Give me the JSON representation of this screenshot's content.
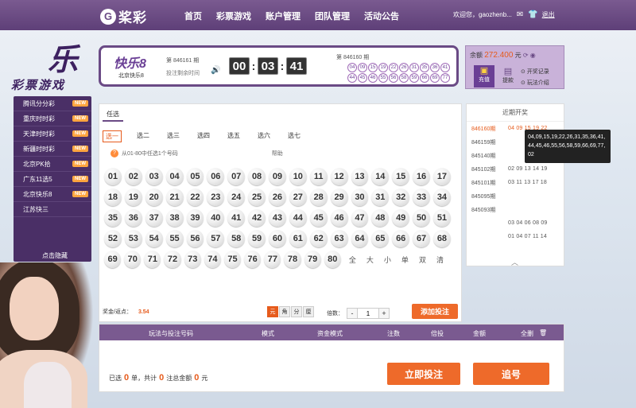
{
  "header": {
    "logo_badge": "G",
    "logo_text": "桨彩",
    "nav": [
      "首页",
      "彩票游戏",
      "账户管理",
      "团队管理",
      "活动公告"
    ],
    "welcome": "欢迎您，gaozhenb...",
    "logout": "退出"
  },
  "promo": {
    "title": "乐",
    "subtitle": "彩票游戏"
  },
  "sidebar": {
    "items": [
      {
        "label": "腾讯分分彩",
        "badge": "NEW"
      },
      {
        "label": "重庆时时彩",
        "badge": "NEW"
      },
      {
        "label": "天津时时彩",
        "badge": "NEW"
      },
      {
        "label": "新疆时时彩",
        "badge": "NEW"
      },
      {
        "label": "北京PK拾",
        "badge": "NEW"
      },
      {
        "label": "广东11选5",
        "badge": "NEW"
      },
      {
        "label": "北京快乐8",
        "badge": "NEW"
      },
      {
        "label": "江苏快三",
        "badge": ""
      }
    ],
    "hide": "点击隐藏"
  },
  "game": {
    "logo": "快乐8",
    "name": "北京快乐8",
    "issue_now": "第 846161 期",
    "issue_label": "投注剩余时间",
    "timer": [
      "00",
      "03",
      "41"
    ],
    "last_issue": "第 846160 期",
    "last_balls": [
      "04",
      "09",
      "15",
      "19",
      "22",
      "26",
      "31",
      "35",
      "36",
      "41",
      "44",
      "45",
      "46",
      "55",
      "56",
      "58",
      "59",
      "66",
      "69",
      "77"
    ]
  },
  "balance": {
    "label": "余额",
    "amount": "272.400",
    "unit": "元",
    "recharge": "充值",
    "withdraw": "提款",
    "link_record": "开奖记录",
    "link_intro": "玩法介绍"
  },
  "play": {
    "tab": "任选",
    "subtabs": [
      "选一",
      "选二",
      "选三",
      "选四",
      "选五",
      "选六",
      "选七"
    ],
    "hint": "从01-80中任选1个号码",
    "help": "帮助",
    "rows": [
      [
        "01",
        "02",
        "03",
        "04",
        "05",
        "06",
        "07",
        "08",
        "09",
        "10",
        "11",
        "12",
        "13",
        "14",
        "15",
        "16",
        "17"
      ],
      [
        "18",
        "19",
        "20",
        "21",
        "22",
        "23",
        "24",
        "25",
        "26",
        "27",
        "28",
        "29",
        "30",
        "31",
        "32",
        "33",
        "34"
      ],
      [
        "35",
        "36",
        "37",
        "38",
        "39",
        "40",
        "41",
        "42",
        "43",
        "44",
        "45",
        "46",
        "47",
        "48",
        "49",
        "50",
        "51"
      ],
      [
        "52",
        "53",
        "54",
        "55",
        "56",
        "57",
        "58",
        "59",
        "60",
        "61",
        "62",
        "63",
        "64",
        "65",
        "66",
        "67",
        "68"
      ],
      [
        "69",
        "70",
        "71",
        "72",
        "73",
        "74",
        "75",
        "76",
        "77",
        "78",
        "79",
        "80"
      ]
    ],
    "quick": [
      "全",
      "大",
      "小",
      "单",
      "双",
      "清"
    ],
    "odds_label": "奖金/返点：",
    "odds_value": "3.54",
    "units": [
      "元",
      "角",
      "分",
      "厘"
    ],
    "multiple_label": "倍数：",
    "multiple_value": "1",
    "minus": "-",
    "plus": "+",
    "add_bet": "添加投注"
  },
  "recent": {
    "title": "近期开奖",
    "rows": [
      {
        "issue": "846160期",
        "nums": "04 09 15 19 22"
      },
      {
        "issue": "846159期",
        "nums": ""
      },
      {
        "issue": "845140期",
        "nums": ""
      },
      {
        "issue": "845102期",
        "nums": "02 09 13 14 19"
      },
      {
        "issue": "845101期",
        "nums": "03 11 13 17 18"
      },
      {
        "issue": "845095期",
        "nums": ""
      },
      {
        "issue": "845093期",
        "nums": ""
      },
      {
        "issue": "",
        "nums": "03 04 06 08 09"
      },
      {
        "issue": "",
        "nums": "01 04 07 11 14"
      }
    ],
    "tooltip": "04,09,15,19,22,26,31,35,36,41,44,45,46,55,56,58,59,66,69,77,02"
  },
  "bets": {
    "columns": [
      "玩法与投注号码",
      "模式",
      "资金模式",
      "注数",
      "倍投",
      "金额",
      "全删"
    ],
    "footer": {
      "pre": "已选",
      "count": "0",
      "mid1": "单，共计",
      "bets": "0",
      "mid2": "注总金额",
      "amount": "0",
      "post": "元"
    },
    "submit": "立即投注",
    "chase": "追号"
  }
}
